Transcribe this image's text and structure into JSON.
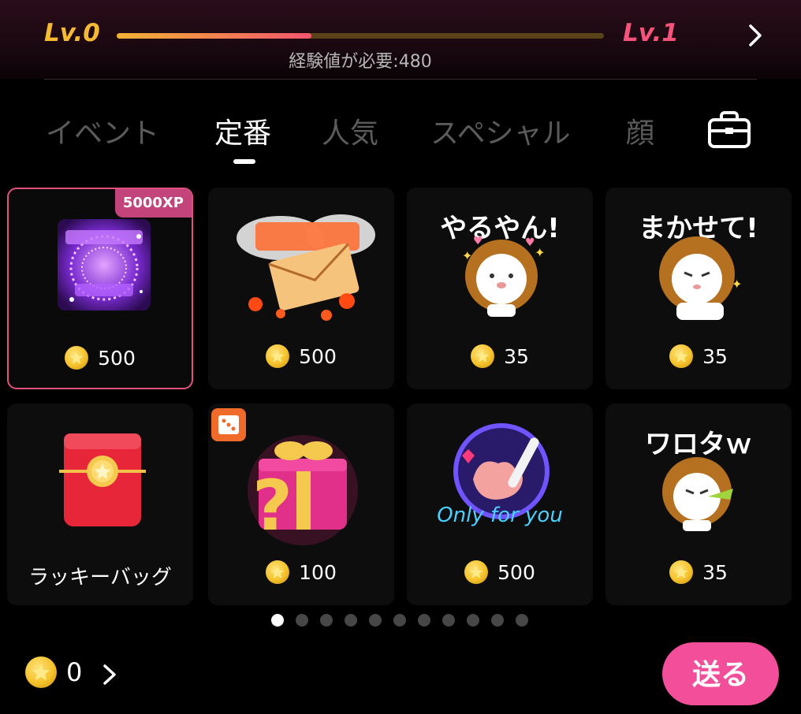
{
  "level": {
    "current": "Lv.0",
    "next": "Lv.1",
    "progress": 0.4,
    "xp_needed_text": "経験値が必要:480"
  },
  "tabs": [
    {
      "label": "イベント",
      "active": false
    },
    {
      "label": "定番",
      "active": true
    },
    {
      "label": "人気",
      "active": false
    },
    {
      "label": "スペシャル",
      "active": false
    },
    {
      "label": "顔",
      "active": false
    }
  ],
  "gifts": [
    {
      "price": "500",
      "badge": "5000XP",
      "selected": true
    },
    {
      "price": "500"
    },
    {
      "price": "35",
      "sticker_text": "やるやん!"
    },
    {
      "price": "35",
      "sticker_text": "まかせて!"
    },
    {
      "name": "ラッキーバッグ"
    },
    {
      "price": "100"
    },
    {
      "price": "500",
      "art_text": "Only for you"
    },
    {
      "price": "35",
      "sticker_text": "ワロタｗ"
    }
  ],
  "pagination": {
    "total": 11,
    "active": 0
  },
  "balance": {
    "amount": "0"
  },
  "send_button": {
    "label": "送る"
  },
  "colors": {
    "accent": "#f24e9a",
    "level_left": "#f5b932",
    "level_right": "#f5537a"
  }
}
